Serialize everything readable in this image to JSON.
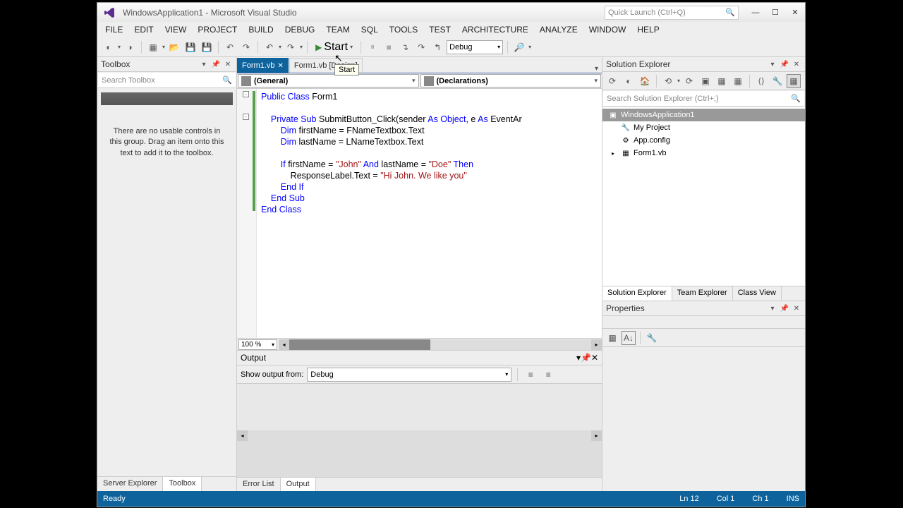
{
  "title": "WindowsApplication1 - Microsoft Visual Studio",
  "quickLaunch": "Quick Launch (Ctrl+Q)",
  "menu": [
    "FILE",
    "EDIT",
    "VIEW",
    "PROJECT",
    "BUILD",
    "DEBUG",
    "TEAM",
    "SQL",
    "TOOLS",
    "TEST",
    "ARCHITECTURE",
    "ANALYZE",
    "WINDOW",
    "HELP"
  ],
  "toolbar": {
    "start": "Start",
    "config": "Debug"
  },
  "tooltip": "Start",
  "toolbox": {
    "title": "Toolbox",
    "search": "Search Toolbox",
    "empty": "There are no usable controls in this group. Drag an item onto this text to add it to the toolbox."
  },
  "leftTabs": [
    "Server Explorer",
    "Toolbox"
  ],
  "docTabs": [
    {
      "name": "Form1.vb",
      "active": true
    },
    {
      "name": "Form1.vb [Design]",
      "active": false
    }
  ],
  "combos": {
    "left": "(General)",
    "right": "(Declarations)"
  },
  "zoom": "100 %",
  "code": {
    "l1a": "Public",
    "l1b": " Class ",
    "l1c": "Form1",
    "l2a": "    Private",
    "l2b": " Sub ",
    "l2c": "SubmitButton_Click(sender ",
    "l2d": "As",
    "l2e": " Object",
    "l2f": ", e ",
    "l2g": "As",
    "l2h": " EventAr",
    "l3a": "        Dim",
    "l3b": " firstName = FNameTextbox.Text",
    "l4a": "        Dim",
    "l4b": " lastName = LNameTextbox.Text",
    "l5a": "        If",
    "l5b": " firstName = ",
    "l5c": "\"John\"",
    "l5d": " And ",
    "l5e": "lastName = ",
    "l5f": "\"Doe\"",
    "l5g": " Then",
    "l6a": "            ResponseLabel.Text = ",
    "l6b": "\"Hi John. We like you\"",
    "l7": "        End If",
    "l8": "    End Sub",
    "l9": "End Class"
  },
  "output": {
    "title": "Output",
    "showFrom": "Show output from:",
    "source": "Debug"
  },
  "outTabs": [
    "Error List",
    "Output"
  ],
  "solutionExplorer": {
    "title": "Solution Explorer",
    "search": "Search Solution Explorer (Ctrl+;)",
    "tree": [
      {
        "name": "WindowsApplication1",
        "indent": 0,
        "sel": true,
        "icon": "▣"
      },
      {
        "name": "My Project",
        "indent": 1,
        "icon": "🔑"
      },
      {
        "name": "App.config",
        "indent": 1,
        "icon": "⚙"
      },
      {
        "name": "Form1.vb",
        "indent": 1,
        "icon": "▸",
        "expand": "▸"
      }
    ]
  },
  "rightTabs": [
    "Solution Explorer",
    "Team Explorer",
    "Class View"
  ],
  "properties": {
    "title": "Properties"
  },
  "status": {
    "ready": "Ready",
    "ln": "Ln 12",
    "col": "Col 1",
    "ch": "Ch 1",
    "ins": "INS"
  }
}
